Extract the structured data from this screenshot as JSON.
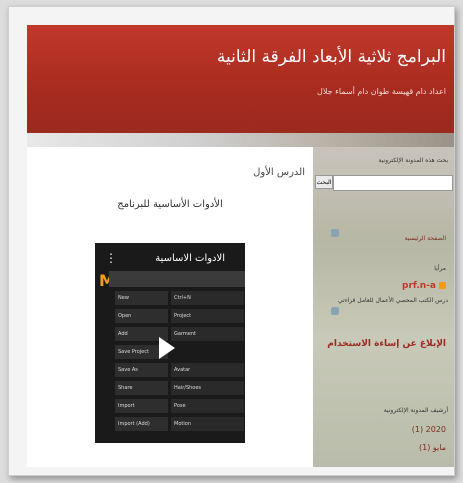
{
  "header": {
    "title": "البرامج ثلاثية الأبعاد الفرقة الثانية",
    "subtitle": "اعداد دام قهيسة طوان دام أسماء جلال"
  },
  "post": {
    "title": "الدرس الأول",
    "heading": "الأدوات الأساسية للبرنامج"
  },
  "video": {
    "title": "الادوات الاساسية",
    "logo": "M",
    "menu": [
      "File",
      "Edit",
      "3D Garment",
      "2D Pattern",
      "Sewing",
      "Materials"
    ],
    "left_items": [
      "New",
      "Open",
      "Add",
      "Save Project",
      "Save As",
      "Share",
      "Import",
      "Import (Add)"
    ],
    "right_items": [
      "Ctrl+N",
      "Project",
      "Garment",
      "Avatar",
      "Hair/Shoes",
      "Pose",
      "Motion"
    ]
  },
  "sidebar": {
    "search_label": "بحث هذه المدونة الإلكترونية",
    "search_button": "البحث",
    "home": "الصفحة الرئيسية",
    "follow_label": "مرأيا",
    "pdf_label": "prf.n-a",
    "file_desc": "درس الكتب المحصي الأعمال للعامل قراءتي",
    "report": "الإبلاغ عن إساءة الاستخدام",
    "archive_label": "أرشيف المدونة الإلكترونية",
    "year": "2020 (1)",
    "month": "مايو (1)"
  }
}
